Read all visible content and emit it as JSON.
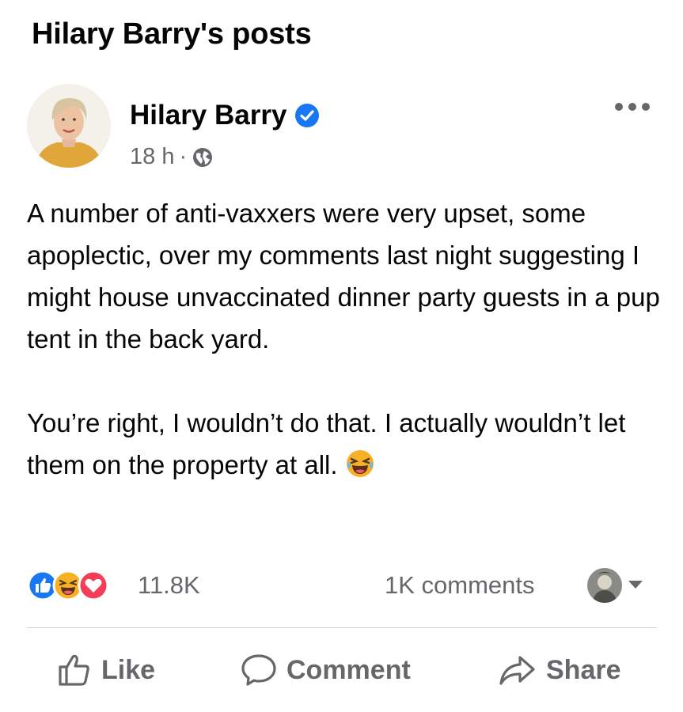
{
  "page": {
    "title": "Hilary Barry's posts"
  },
  "post": {
    "author": "Hilary Barry",
    "time": "18 h",
    "separator": "·",
    "body": [
      "A number of anti-vaxxers were very upset, some apoplectic, over my comments last night suggesting I might house unvaccinated dinner party guests in a pup tent in the back yard.",
      "You’re right, I wouldn’t do that. I actually wouldn’t let them on the property at all."
    ],
    "reaction_count": "11.8K",
    "comments_count": "1K comments",
    "reactions": [
      "like-icon",
      "laughing-emoji-icon",
      "love-icon"
    ]
  },
  "actions": {
    "like": "Like",
    "comment": "Comment",
    "share": "Share"
  },
  "colors": {
    "text": "#050505",
    "secondary": "#65676b",
    "facebook_blue": "#1877f2",
    "love_red": "#f33e58",
    "haha_yellow": "#f7b125",
    "divider": "#ced0d4"
  }
}
